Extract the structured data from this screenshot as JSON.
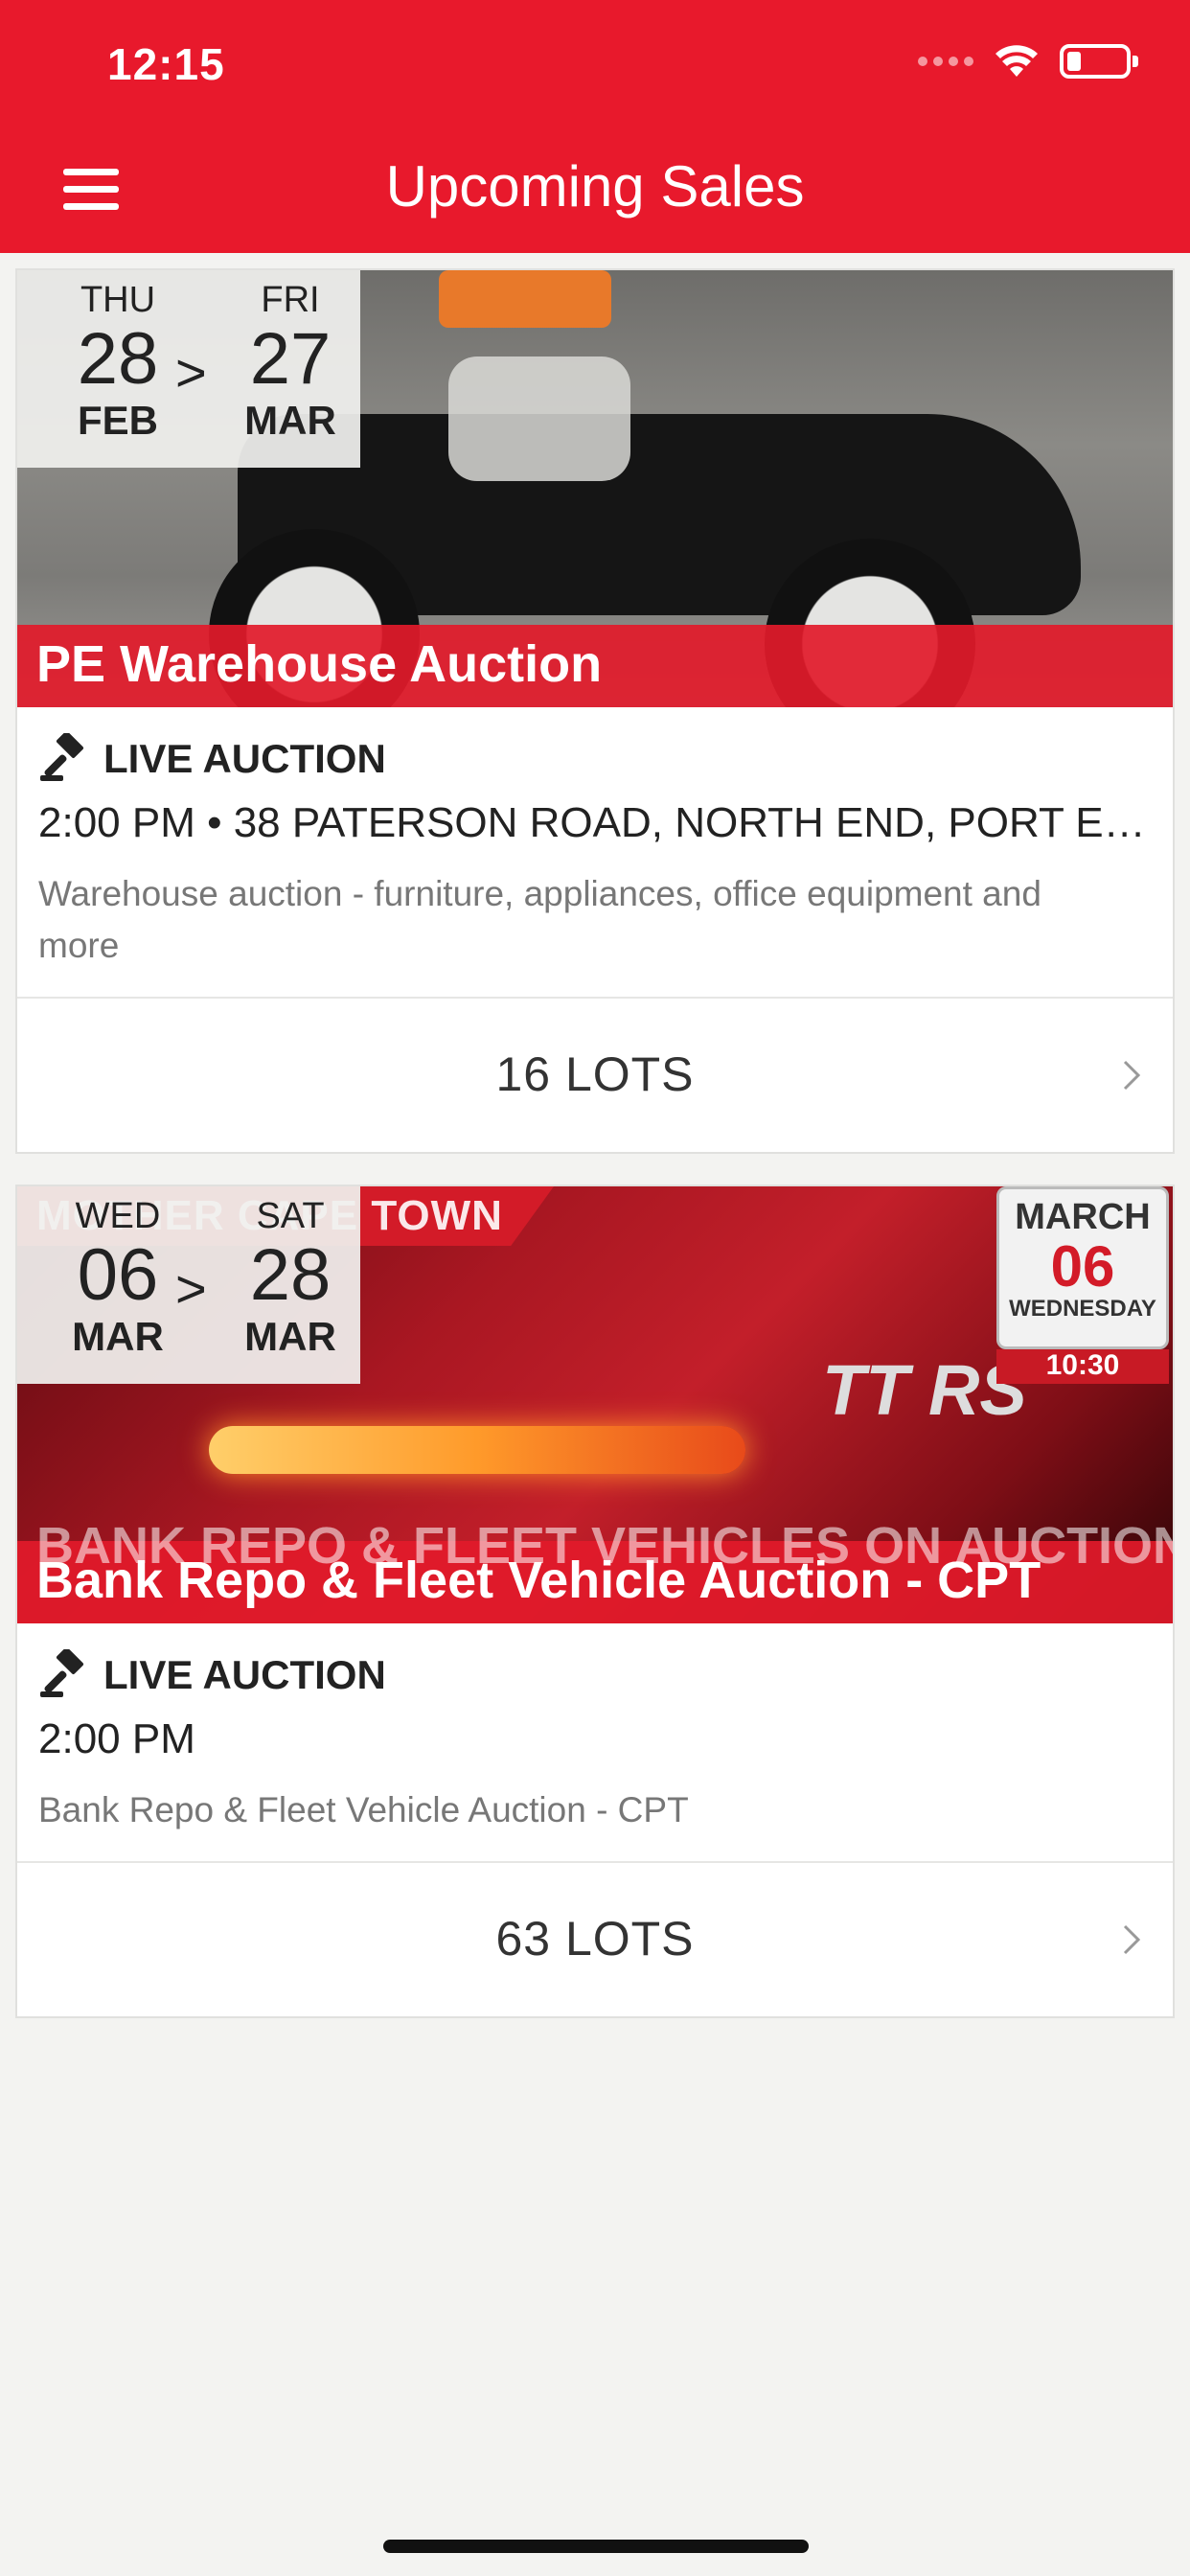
{
  "status": {
    "time": "12:15"
  },
  "nav": {
    "title": "Upcoming Sales"
  },
  "sales": [
    {
      "start": {
        "dow": "THU",
        "day": "28",
        "mon": "FEB"
      },
      "end": {
        "dow": "FRI",
        "day": "27",
        "mon": "MAR"
      },
      "arrow": ">",
      "name": "PE Warehouse Auction",
      "type": "LIVE AUCTION",
      "time_location": "2:00 PM • 38 PATERSON ROAD, NORTH END, PORT E…",
      "description": "Warehouse auction - furniture, appliances, office equipment and more",
      "lots": "16 LOTS"
    },
    {
      "start": {
        "dow": "WED",
        "day": "06",
        "mon": "MAR"
      },
      "end": {
        "dow": "SAT",
        "day": "28",
        "mon": "MAR"
      },
      "arrow": ">",
      "name": "Bank Repo & Fleet Vehicle Auction - CPT",
      "type": "LIVE AUCTION",
      "time_location": "2:00 PM",
      "description": "Bank Repo & Fleet Vehicle Auction - CPT",
      "lots": "63 LOTS",
      "promo": {
        "banner": "MOTHER CAPE TOWN AUCTION",
        "cal_month": "MARCH",
        "cal_day": "06",
        "cal_weekday": "WEDNESDAY",
        "cal_time": "10:30",
        "badge": "TT RS",
        "band": "BANK REPO & FLEET VEHICLES ON AUCTION"
      }
    }
  ],
  "colors": {
    "brand_red": "#e8192c",
    "background": "#f3f3f1"
  },
  "icons": {
    "menu": "hamburger-icon",
    "gavel": "gavel-icon",
    "chevron": "chevron-right-icon",
    "wifi": "wifi-icon",
    "battery": "battery-icon"
  }
}
